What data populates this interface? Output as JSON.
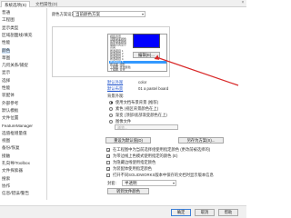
{
  "window": {
    "tabs": [
      {
        "label": "系统选项(S)"
      },
      {
        "label": "文档属性(D)"
      }
    ],
    "close_glyph": "×"
  },
  "sidebar": {
    "items": [
      {
        "label": "普通"
      },
      {
        "label": "工程图"
      },
      {
        "label": "显示类型"
      },
      {
        "label": "区域剖面线/填充"
      },
      {
        "label": "性能"
      },
      {
        "label": "颜色"
      },
      {
        "label": "草图"
      },
      {
        "label": "几何关系/捕捉"
      },
      {
        "label": "显示"
      },
      {
        "label": "选择"
      },
      {
        "label": "性能"
      },
      {
        "label": "装配体"
      },
      {
        "label": "外部参考"
      },
      {
        "label": "默认模板"
      },
      {
        "label": "文件位置"
      },
      {
        "label": "FeatureManager"
      },
      {
        "label": "选值框增量值"
      },
      {
        "label": "视图"
      },
      {
        "label": "备份/恢复"
      },
      {
        "label": "接触"
      },
      {
        "label": "孔向导/Toolbox"
      },
      {
        "label": "文件探索器"
      },
      {
        "label": "搜索"
      },
      {
        "label": "协作"
      },
      {
        "label": "信息/错误/警告"
      }
    ]
  },
  "colors": {
    "scheme_label": "颜色方案设置",
    "scheme_combo": "当前颜色方案",
    "list_items": [
      {
        "label": "视区背景"
      },
      {
        "label": "顶部渐变颜色"
      },
      {
        "label": "底部渐变颜色"
      },
      {
        "label": "动态高亮显示"
      },
      {
        "label": "高亮"
      },
      {
        "label": "所选项目 1"
      },
      {
        "label": "所选项目 2"
      },
      {
        "label": "所选项目 3"
      },
      {
        "label": "所选项目 4"
      },
      {
        "label": "所选项目 5"
      },
      {
        "label": "所选面, 阴影"
      },
      {
        "label": "工程图, 纸张颜色"
      },
      {
        "label": "工程图, 背景"
      }
    ],
    "selected_index": 9,
    "edit_button": "编辑(E)...",
    "swatch_color": "#0000ff",
    "sel_highlight_color": "#3399ff",
    "default_colors": "默认外观",
    "default_value": "color",
    "default_scene": "默认布景",
    "scene_value": "01 a pastel board",
    "background_label": "背景外观:",
    "background_options": [
      {
        "label": "使用文档布景背景 (推荐)"
      },
      {
        "label": "素色 (视区背景颜色在上)"
      },
      {
        "label": "渐变 (顶部/底部渐变颜色在上)"
      },
      {
        "label": "图像文件"
      }
    ],
    "background_selected": 0,
    "image_placeholder": "浏览...",
    "reset_button": "重设为默认值(D)",
    "save_scheme_button": "另存为方案(S)...",
    "options": [
      {
        "label": "在工程图中为当前选择组使用指定颜色 (更改前被选择的)",
        "checked": true
      },
      {
        "label": "为带边线上色模式使用指定的颜色 (E)",
        "checked": true
      },
      {
        "label": "为隐藏边线使用指定颜色",
        "checked": false
      },
      {
        "label": "为装配体使用指定颜色",
        "checked": true
      },
      {
        "label": "打开不同SOLIDWORKS版本中保存的文档时显示版本信息",
        "checked": false
      }
    ],
    "envelope_label": "封套:",
    "envelope_value": "半透明",
    "goto_button": "转到文件颜色"
  },
  "footer": {
    "ok": "确定",
    "cancel": "取消",
    "help": "帮助"
  }
}
